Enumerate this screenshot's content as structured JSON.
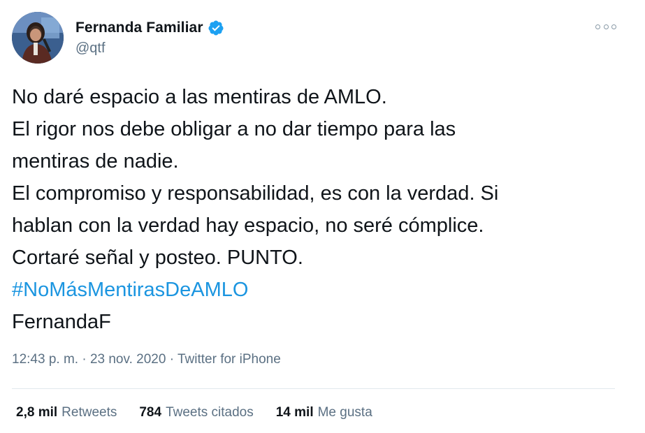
{
  "user": {
    "display_name": "Fernanda Familiar",
    "handle": "@qtf",
    "verified_icon": "verified-badge-icon",
    "verified_color": "#1da1f2"
  },
  "menu": {
    "more_icon": "more-options-icon"
  },
  "tweet": {
    "lines": [
      "No daré espacio a las mentiras de AMLO.",
      "El rigor nos debe obligar a no dar tiempo para las",
      "mentiras de nadie.",
      "El compromiso y responsabilidad, es con la verdad. Si",
      "hablan con la verdad hay espacio, no seré cómplice.",
      "Cortaré señal y posteo. PUNTO."
    ],
    "hashtag": "#NoMásMentirasDeAMLO",
    "signature": "FernandaF",
    "hashtag_color": "#1b95e0"
  },
  "meta": {
    "time": "12:43 p. m.",
    "separator": " · ",
    "date": "23 nov. 2020",
    "source": "Twitter for iPhone"
  },
  "stats": {
    "retweets_count": "2,8 mil",
    "retweets_label": "Retweets",
    "quotes_count": "784",
    "quotes_label": "Tweets citados",
    "likes_count": "14 mil",
    "likes_label": "Me gusta"
  }
}
